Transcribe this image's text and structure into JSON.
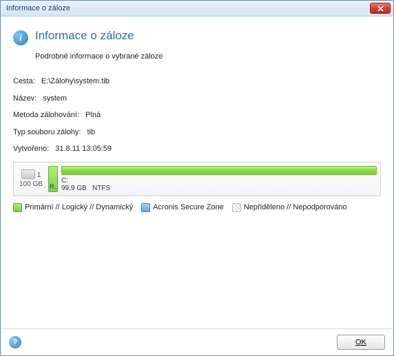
{
  "window": {
    "title": "Informace o záloze"
  },
  "header": {
    "heading": "Informace o záloze",
    "subtitle": "Podrobné informace o vybrané záloze"
  },
  "fields": {
    "path_label": "Cesta:",
    "path_value": "E:\\Zálohy\\system.tib",
    "name_label": "Název:",
    "name_value": "system",
    "method_label": "Metoda zálohování:",
    "method_value": "Plná",
    "type_label": "Typ souboru zálohy:",
    "type_value": "tib",
    "created_label": "Vytvořeno:",
    "created_value": "31.8.11 13:05:59"
  },
  "disk": {
    "index": "1",
    "size": "100 GB",
    "partitions": [
      {
        "label": "R…",
        "size": "",
        "fs": ""
      },
      {
        "label": "C:",
        "size": "99,9 GB",
        "fs": "NTFS"
      }
    ]
  },
  "legend": {
    "primary": "Primární // Logický // Dynamický",
    "asz": "Acronis Secure Zone",
    "unalloc": "Nepřiděleno // Nepodporováno"
  },
  "footer": {
    "ok_label": "OK"
  },
  "icons": {
    "close": "close-icon",
    "info": "info-icon",
    "help": "help-icon",
    "disk": "disk-icon"
  }
}
